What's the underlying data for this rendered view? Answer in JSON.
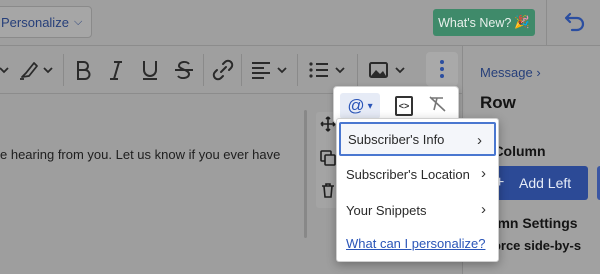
{
  "topbar": {
    "personalize_label": "Personalize",
    "whats_new_label": "What's New?",
    "whats_new_emoji": "🎉"
  },
  "editor": {
    "body_text": "e hearing from you. Let us know if you ever have"
  },
  "right_panel": {
    "breadcrumb": "Message",
    "title": "Row",
    "subtitle": "d Column",
    "add_left_label": "Add Left",
    "column_settings": "lumn Settings",
    "force_label": "Force side-by-s"
  },
  "menu": {
    "items": [
      {
        "label": "Subscriber's Info"
      },
      {
        "label": "Subscriber's Location"
      },
      {
        "label": "Your Snippets"
      }
    ],
    "link": "What can I personalize?"
  },
  "colors": {
    "accent": "#2a55b8",
    "primary_button": "#2c4a96",
    "whats_new_bg": "#3f8a6a"
  }
}
